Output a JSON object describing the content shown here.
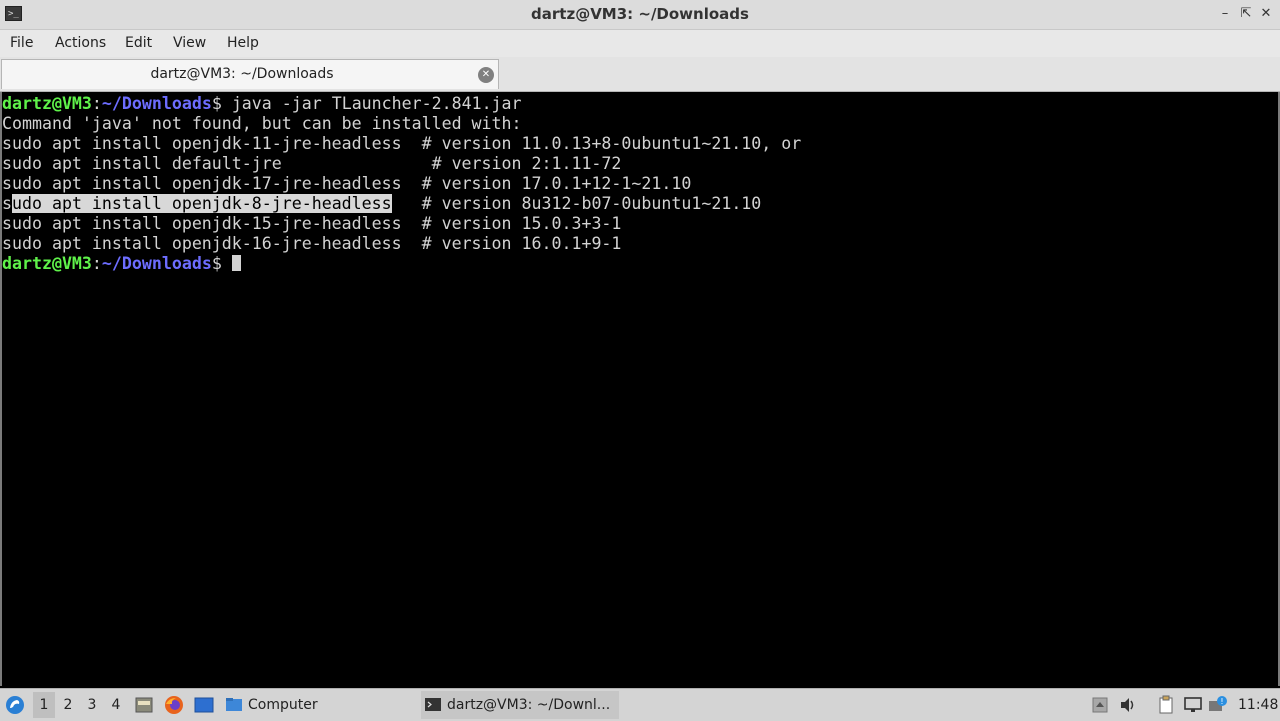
{
  "window": {
    "title": "dartz@VM3: ~/Downloads",
    "app_icon": "terminal-icon",
    "controls": [
      "minimize",
      "restore",
      "close"
    ]
  },
  "menu": [
    "File",
    "Actions",
    "Edit",
    "View",
    "Help"
  ],
  "tab": {
    "label": "dartz@VM3: ~/Downloads"
  },
  "terminal": {
    "prompt_user": "dartz@VM3",
    "prompt_path": "~/Downloads",
    "prompt_suffix": "$ ",
    "command": "java -jar TLauncher-2.841.jar",
    "message": "Command 'java' not found, but can be installed with:",
    "lines": [
      {
        "cmd": "sudo apt install openjdk-11-jre-headless",
        "note": "  # version 11.0.13+8-0ubuntu1~21.10, or"
      },
      {
        "cmd": "sudo apt install default-jre             ",
        "note": "  # version 2:1.11-72"
      },
      {
        "cmd": "sudo apt install openjdk-17-jre-headless",
        "note": "  # version 17.0.1+12-1~21.10"
      },
      {
        "cmd": "sudo apt install openjdk-8-jre-headless ",
        "note": "  # version 8u312-b07-0ubuntu1~21.10"
      },
      {
        "cmd": "sudo apt install openjdk-15-jre-headless",
        "note": "  # version 15.0.3+3-1"
      },
      {
        "cmd": "sudo apt install openjdk-16-jre-headless",
        "note": "  # version 16.0.1+9-1"
      }
    ],
    "selected_line_index": 3,
    "selected_text": "udo apt install openjdk-8-jre-headless",
    "colors": {
      "background": "#000000",
      "text": "#d3d3d3",
      "prompt_user": "#5ff24a",
      "prompt_path": "#6d6dff",
      "selection": "#d8d8d8"
    }
  },
  "taskbar": {
    "start_icon": "lubuntu-start-icon",
    "workspaces": [
      "1",
      "2",
      "3",
      "4"
    ],
    "active_workspace": "1",
    "launchers": [
      "file-manager-icon",
      "firefox-icon",
      "desktop-icon"
    ],
    "computer_button": "Computer",
    "window_button": "dartz@VM3: ~/Downl...",
    "tray_icons": [
      "tray-arrow-icon",
      "volume-icon",
      "clipboard-icon",
      "network-icon",
      "update-notifier-icon"
    ],
    "clock": "11:48"
  }
}
